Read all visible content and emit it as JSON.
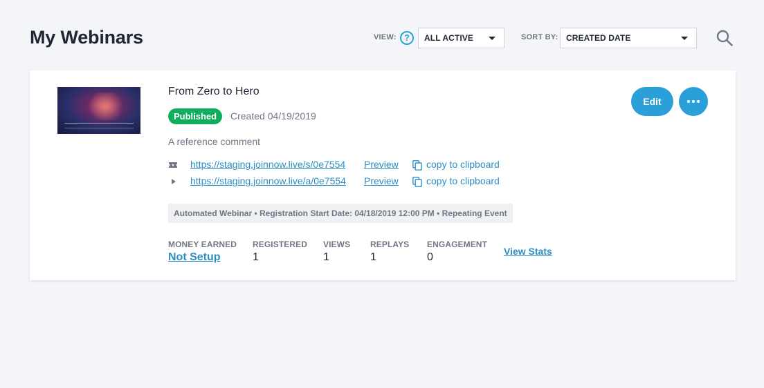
{
  "page": {
    "title": "My Webinars"
  },
  "filters": {
    "view_label": "VIEW:",
    "view_help": "?",
    "view_value": "ALL ACTIVE",
    "sort_label": "SORT BY:",
    "sort_value": "CREATED DATE"
  },
  "webinar": {
    "title": "From Zero to Hero",
    "status": "Published",
    "created": "Created 04/19/2019",
    "comment": "A reference comment",
    "links": [
      {
        "icon": "ticket-icon",
        "url": "https://staging.joinnow.live/s/0e7554",
        "preview_label": "Preview",
        "copy_label": "copy to clipboard"
      },
      {
        "icon": "play-icon",
        "url": "https://staging.joinnow.live/a/0e7554",
        "preview_label": "Preview",
        "copy_label": "copy to clipboard"
      }
    ],
    "info": "Automated Webinar • Registration Start Date: 04/18/2019 12:00 PM • Repeating Event",
    "stats": [
      {
        "label": "MONEY EARNED",
        "value": "Not Setup"
      },
      {
        "label": "REGISTERED",
        "value": "1"
      },
      {
        "label": "VIEWS",
        "value": "1"
      },
      {
        "label": "REPLAYS",
        "value": "1"
      },
      {
        "label": "ENGAGEMENT",
        "value": "0"
      }
    ],
    "view_stats_label": "View Stats",
    "edit_label": "Edit"
  },
  "colors": {
    "accent": "#2b9fd8",
    "published": "#0fae5e",
    "background": "#f3f5f9"
  }
}
